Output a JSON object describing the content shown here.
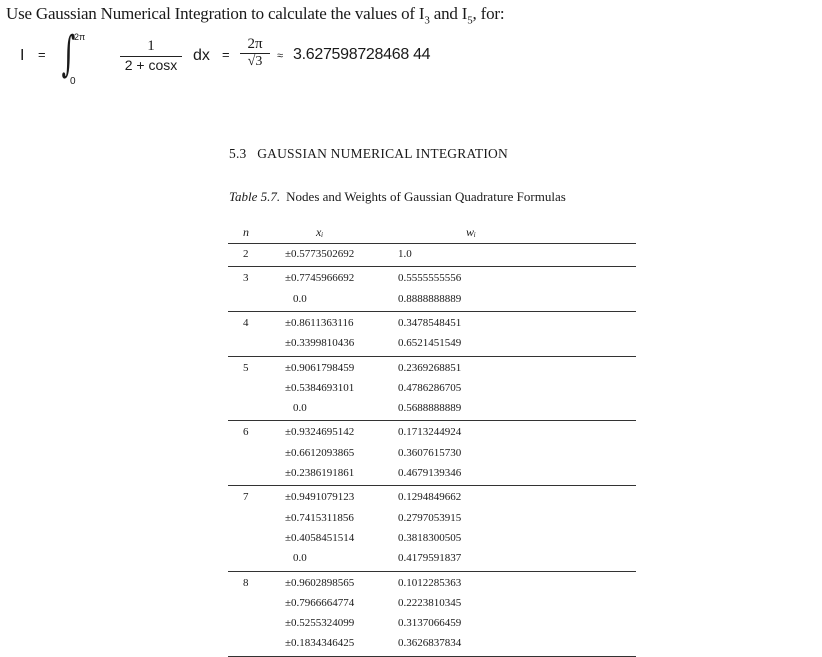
{
  "prompt": {
    "text_before": "Use Gaussian Numerical Integration to calculate the values of ",
    "i3_main": "I",
    "i3_sub": "3",
    "and": " and ",
    "i5_main": "I",
    "i5_sub": "5",
    "text_after": ", for:"
  },
  "formula": {
    "lhs": "I",
    "eq": "=",
    "integral_sign": "∫",
    "upper_limit": "2π",
    "lower_limit": "0",
    "numerator": "1",
    "denominator": "2 + cosx",
    "dx": "dx",
    "eq2": "=",
    "closed_num": "2π",
    "closed_den": "√3",
    "approx": "≈",
    "value": "3.627598728468 44"
  },
  "section_heading": "5.3   GAUSSIAN NUMERICAL INTEGRATION",
  "table": {
    "caption_label": "Table 5.7.",
    "caption_text": "Nodes and Weights of Gaussian Quadrature Formulas",
    "headers": {
      "n": "n",
      "x": "xᵢ",
      "w": "wᵢ"
    },
    "groups": [
      {
        "n": "2",
        "rows": [
          {
            "x": "±0.5773502692",
            "w": "1.0"
          }
        ]
      },
      {
        "n": "3",
        "rows": [
          {
            "x": "±0.7745966692",
            "w": "0.5555555556"
          },
          {
            "x": "0.0",
            "w": "0.8888888889"
          }
        ]
      },
      {
        "n": "4",
        "rows": [
          {
            "x": "±0.8611363116",
            "w": "0.3478548451"
          },
          {
            "x": "±0.3399810436",
            "w": "0.6521451549"
          }
        ]
      },
      {
        "n": "5",
        "rows": [
          {
            "x": "±0.9061798459",
            "w": "0.2369268851"
          },
          {
            "x": "±0.5384693101",
            "w": "0.4786286705"
          },
          {
            "x": "0.0",
            "w": "0.5688888889"
          }
        ]
      },
      {
        "n": "6",
        "rows": [
          {
            "x": "±0.9324695142",
            "w": "0.1713244924"
          },
          {
            "x": "±0.6612093865",
            "w": "0.3607615730"
          },
          {
            "x": "±0.2386191861",
            "w": "0.4679139346"
          }
        ]
      },
      {
        "n": "7",
        "rows": [
          {
            "x": "±0.9491079123",
            "w": "0.1294849662"
          },
          {
            "x": "±0.7415311856",
            "w": "0.2797053915"
          },
          {
            "x": "±0.4058451514",
            "w": "0.3818300505"
          },
          {
            "x": "0.0",
            "w": "0.4179591837"
          }
        ]
      },
      {
        "n": "8",
        "rows": [
          {
            "x": "±0.9602898565",
            "w": "0.1012285363"
          },
          {
            "x": "±0.7966664774",
            "w": "0.2223810345"
          },
          {
            "x": "±0.5255324099",
            "w": "0.3137066459"
          },
          {
            "x": "±0.1834346425",
            "w": "0.3626837834"
          }
        ]
      }
    ]
  }
}
